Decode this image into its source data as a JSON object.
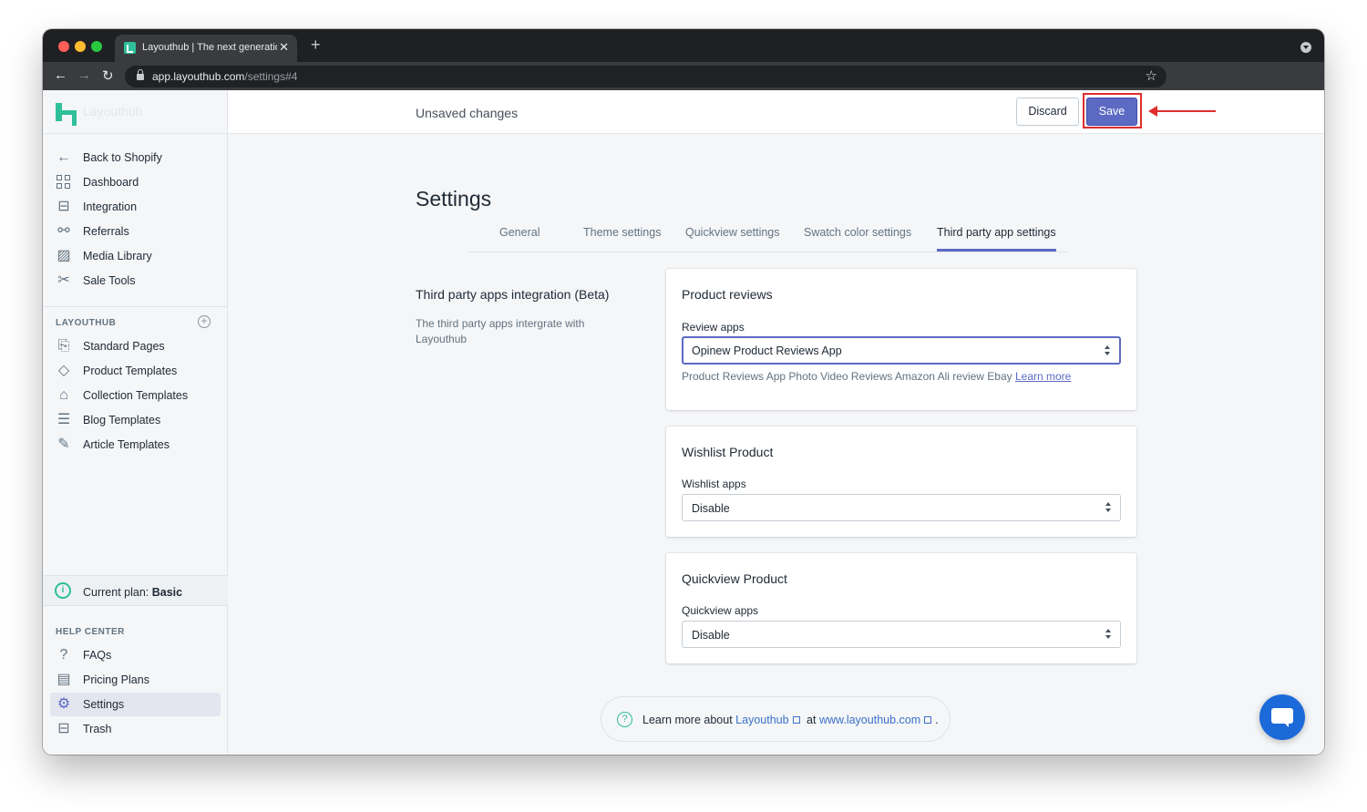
{
  "browser": {
    "tab_title": "Layouthub | The next generatio",
    "url_host": "app.layouthub.com",
    "url_path": "/settings#4"
  },
  "sidebar": {
    "logo_text": "Layouthub",
    "top_items": [
      {
        "label": "Back to Shopify",
        "icon": "arrow-left-icon"
      },
      {
        "label": "Dashboard",
        "icon": "dashboard-icon"
      },
      {
        "label": "Integration",
        "icon": "integration-icon"
      },
      {
        "label": "Referrals",
        "icon": "referrals-icon"
      },
      {
        "label": "Media Library",
        "icon": "image-icon"
      },
      {
        "label": "Sale Tools",
        "icon": "tools-icon"
      }
    ],
    "layouthub_title": "LAYOUTHUB",
    "layouthub_items": [
      {
        "label": "Standard Pages",
        "icon": "page-icon"
      },
      {
        "label": "Product Templates",
        "icon": "tag-icon"
      },
      {
        "label": "Collection Templates",
        "icon": "collection-icon"
      },
      {
        "label": "Blog Templates",
        "icon": "blog-icon"
      },
      {
        "label": "Article Templates",
        "icon": "edit-icon"
      }
    ],
    "plan_label": "Current plan:",
    "plan_value": "Basic",
    "help_title": "HELP CENTER",
    "help_items": [
      {
        "label": "FAQs",
        "icon": "question-icon"
      },
      {
        "label": "Pricing Plans",
        "icon": "clipboard-icon"
      },
      {
        "label": "Settings",
        "icon": "gear-icon",
        "active": true
      },
      {
        "label": "Trash",
        "icon": "trash-icon"
      }
    ]
  },
  "topbar": {
    "status": "Unsaved changes",
    "discard_label": "Discard",
    "save_label": "Save"
  },
  "page": {
    "title": "Settings",
    "tabs": [
      {
        "label": "General"
      },
      {
        "label": "Theme settings"
      },
      {
        "label": "Quickview settings"
      },
      {
        "label": "Swatch color settings"
      },
      {
        "label": "Third party app settings",
        "active": true
      }
    ],
    "section_heading": "Third party apps integration (Beta)",
    "section_desc": "The third party apps intergrate with Layouthub",
    "cards": [
      {
        "title": "Product reviews",
        "field_label": "Review apps",
        "value": "Opinew Product Reviews App",
        "help": "Product Reviews App Photo Video Reviews Amazon Ali review Ebay",
        "help_link": "Learn more"
      },
      {
        "title": "Wishlist Product",
        "field_label": "Wishlist apps",
        "value": "Disable"
      },
      {
        "title": "Quickview Product",
        "field_label": "Quickview apps",
        "value": "Disable"
      }
    ],
    "footer": {
      "prefix": "Learn more about",
      "link1": "Layouthub",
      "middle": "at",
      "link2": "www.layouthub.com",
      "suffix": "."
    }
  },
  "colors": {
    "accent": "#5c6ac4",
    "brand": "#2fbf9b",
    "highlight": "#e02d2d",
    "chat": "#1c6ad9"
  }
}
